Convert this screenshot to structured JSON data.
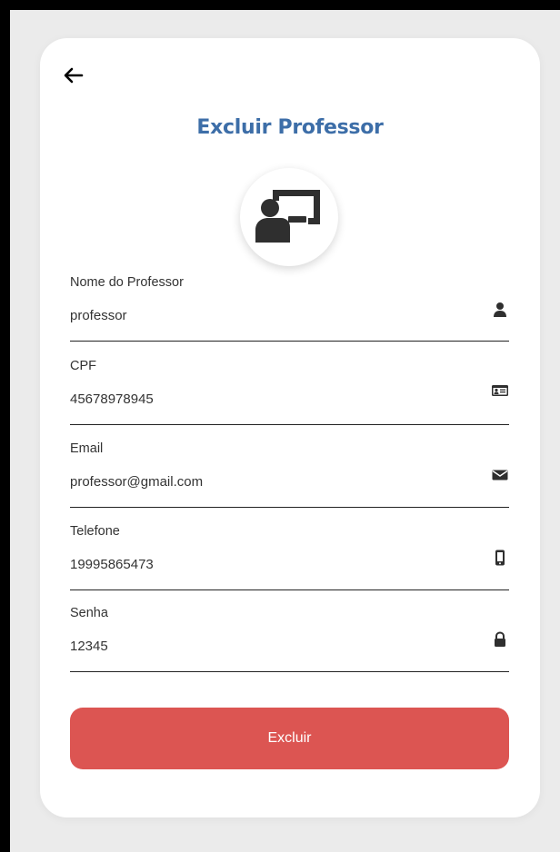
{
  "page": {
    "title": "Excluir Professor",
    "accent_color": "#3d6ea8",
    "danger_color": "#dc5552"
  },
  "header": {
    "back_icon": "arrow-left-icon"
  },
  "avatar": {
    "icon": "chalkboard-teacher-icon"
  },
  "form": {
    "fields": [
      {
        "label": "Nome do Professor",
        "value": "professor",
        "icon": "user-icon"
      },
      {
        "label": "CPF",
        "value": "45678978945",
        "icon": "id-card-icon"
      },
      {
        "label": "Email",
        "value": "professor@gmail.com",
        "icon": "envelope-icon"
      },
      {
        "label": "Telefone",
        "value": "19995865473",
        "icon": "mobile-icon"
      },
      {
        "label": "Senha",
        "value": "12345",
        "icon": "lock-icon"
      }
    ],
    "submit_label": "Excluir"
  }
}
